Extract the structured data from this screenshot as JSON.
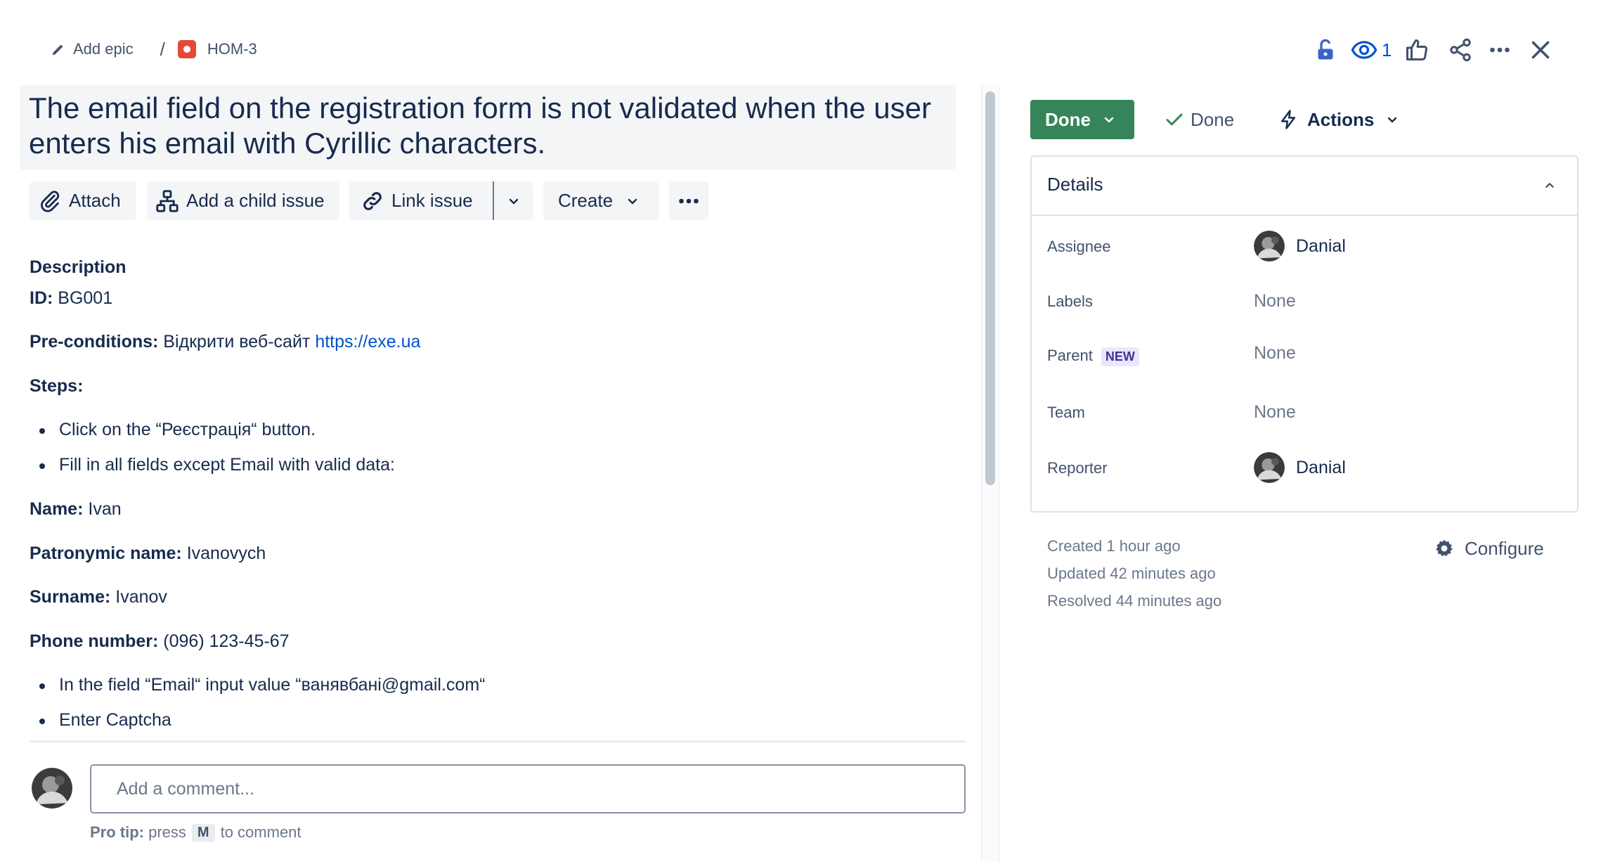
{
  "breadcrumb": {
    "add_epic_label": "Add epic",
    "separator": "/",
    "issue_key": "HOM-3",
    "issue_type_icon": "bug-icon",
    "bug_color": "#e5493a"
  },
  "top_actions": {
    "watch_count": "1",
    "icons": [
      "unlock-icon",
      "eye-icon",
      "thumbs-up-icon",
      "share-icon",
      "more-icon",
      "close-icon"
    ],
    "accent_color": "#0052cc"
  },
  "issue": {
    "title": "The email field on the registration form is not validated when the user enters his email with Cyrillic characters."
  },
  "toolbar": {
    "attach_label": "Attach",
    "child_issue_label": "Add a child issue",
    "link_issue_label": "Link issue",
    "create_label": "Create"
  },
  "description": {
    "heading": "Description",
    "id_label": "ID:",
    "id_value": " BG001",
    "precond_label": "Pre-conditions:",
    "precond_text": " Відкрити веб-сайт ",
    "precond_link": "https://exe.ua",
    "steps_label": "Steps:",
    "step1": "Click on the “Реєстрація“ button.",
    "step2": "Fill in all fields except Email with valid data:",
    "name_label": "Name:",
    "name_value": " Ivan",
    "patronymic_label": "Patronymic name:",
    "patronymic_value": " Ivanovych",
    "surname_label": "Surname:",
    "surname_value": " Ivanov",
    "phone_label": "Phone number:",
    "phone_value": " (096) 123-45-67",
    "step3": "In the field “Email“ input value “ванявбані@gmail.com“",
    "step4": "Enter Captcha"
  },
  "comment": {
    "placeholder": "Add a comment...",
    "protip_label": "Pro tip:",
    "protip_press": " press",
    "protip_key": "M",
    "protip_suffix": "to comment"
  },
  "status": {
    "button_label": "Done",
    "resolution_label": "Done",
    "actions_label": "Actions",
    "done_color": "#36845a"
  },
  "details": {
    "title": "Details",
    "assignee_label": "Assignee",
    "assignee_value": "Danial",
    "labels_label": "Labels",
    "labels_value": "None",
    "parent_label": "Parent",
    "parent_badge": "NEW",
    "parent_value": "None",
    "team_label": "Team",
    "team_value": "None",
    "reporter_label": "Reporter",
    "reporter_value": "Danial"
  },
  "meta": {
    "created": "Created 1 hour ago",
    "updated": "Updated 42 minutes ago",
    "resolved": "Resolved 44 minutes ago",
    "configure_label": "Configure"
  }
}
